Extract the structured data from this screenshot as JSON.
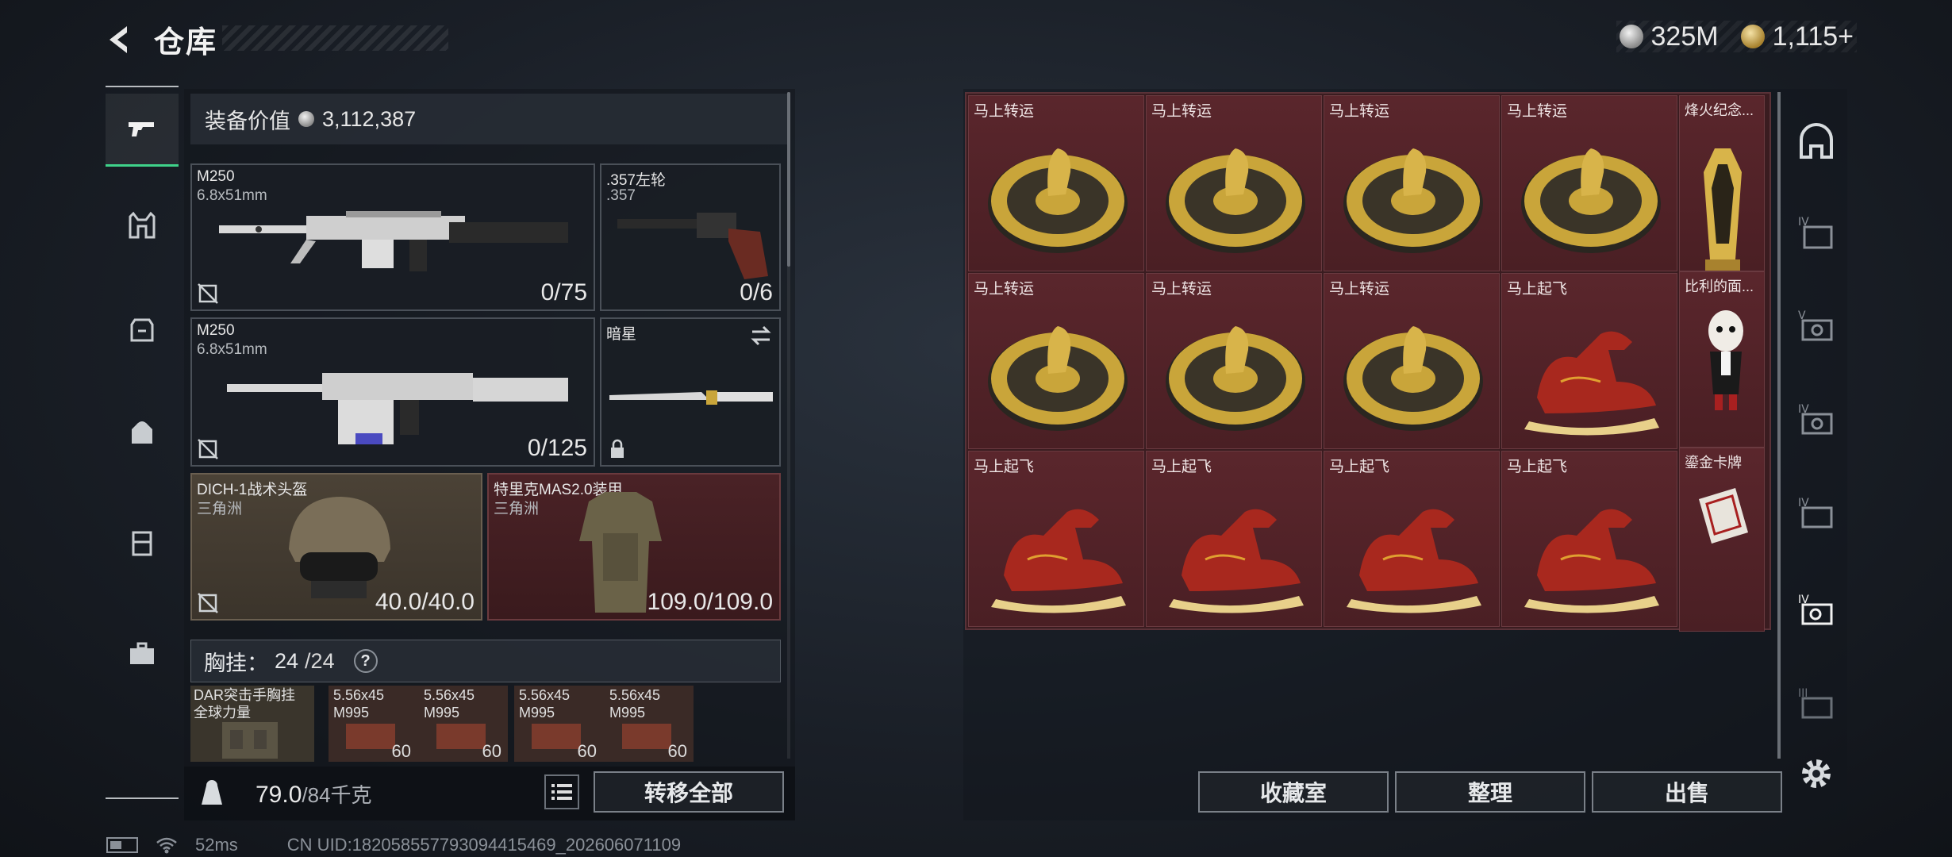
{
  "header": {
    "title": "仓库"
  },
  "currency": {
    "silver": "325M",
    "gold": "1,115+"
  },
  "equipment": {
    "value_label": "装备价值",
    "value": "3,112,387",
    "slots": [
      {
        "name": "M250",
        "sub": "6.8x51mm",
        "count": "0/75"
      },
      {
        "name": ".357左轮",
        "sub": ".357",
        "count": "0/6"
      },
      {
        "name": "M250",
        "sub": "6.8x51mm",
        "count": "0/125"
      },
      {
        "name": "暗星",
        "sub": "",
        "count": ""
      },
      {
        "name": "DICH-1战术头盔",
        "sub": "三角洲",
        "count": "40.0/40.0"
      },
      {
        "name": "特里克MAS2.0装甲",
        "sub": "三角洲",
        "count": "109.0/109.0"
      }
    ],
    "chest": {
      "label": "胸挂：",
      "current": "24",
      "max": "/24",
      "help": "?"
    },
    "small_slots": [
      {
        "name": "DAR突击手胸挂",
        "sub": "全球力量",
        "count": ""
      },
      {
        "name": "5.56x45",
        "sub": "M995",
        "count": "60"
      },
      {
        "name": "5.56x45",
        "sub": "M995",
        "count": "60"
      },
      {
        "name": "5.56x45",
        "sub": "M995",
        "count": "60"
      },
      {
        "name": "5.56x45",
        "sub": "M995",
        "count": "60"
      }
    ],
    "weight": {
      "current": "79.0",
      "max": "/84千克"
    },
    "transfer_label": "转移全部"
  },
  "storage": {
    "cells": [
      {
        "label": "马上转运",
        "kind": "coin"
      },
      {
        "label": "马上转运",
        "kind": "coin"
      },
      {
        "label": "马上转运",
        "kind": "coin"
      },
      {
        "label": "马上转运",
        "kind": "coin"
      },
      {
        "label": "马上转运",
        "kind": "coin"
      },
      {
        "label": "马上转运",
        "kind": "coin"
      },
      {
        "label": "马上转运",
        "kind": "coin"
      },
      {
        "label": "马上起飞",
        "kind": "horse"
      },
      {
        "label": "马上起飞",
        "kind": "horse"
      },
      {
        "label": "马上起飞",
        "kind": "horse"
      },
      {
        "label": "马上起飞",
        "kind": "horse"
      },
      {
        "label": "马上起飞",
        "kind": "horse"
      }
    ],
    "side_items": [
      {
        "label": "烽火纪念..."
      },
      {
        "label": "比利的面..."
      },
      {
        "label": "鎏金卡牌"
      }
    ],
    "buttons": {
      "collection": "收藏室",
      "sort": "整理",
      "sell": "出售"
    }
  },
  "status": {
    "ping": "52ms",
    "uid": "CN UID:182058557793094415469_202606071109"
  },
  "colors": {
    "accent": "#3fd28a",
    "cell_bg": "#4a1f24",
    "gold": "#c9a53a"
  }
}
